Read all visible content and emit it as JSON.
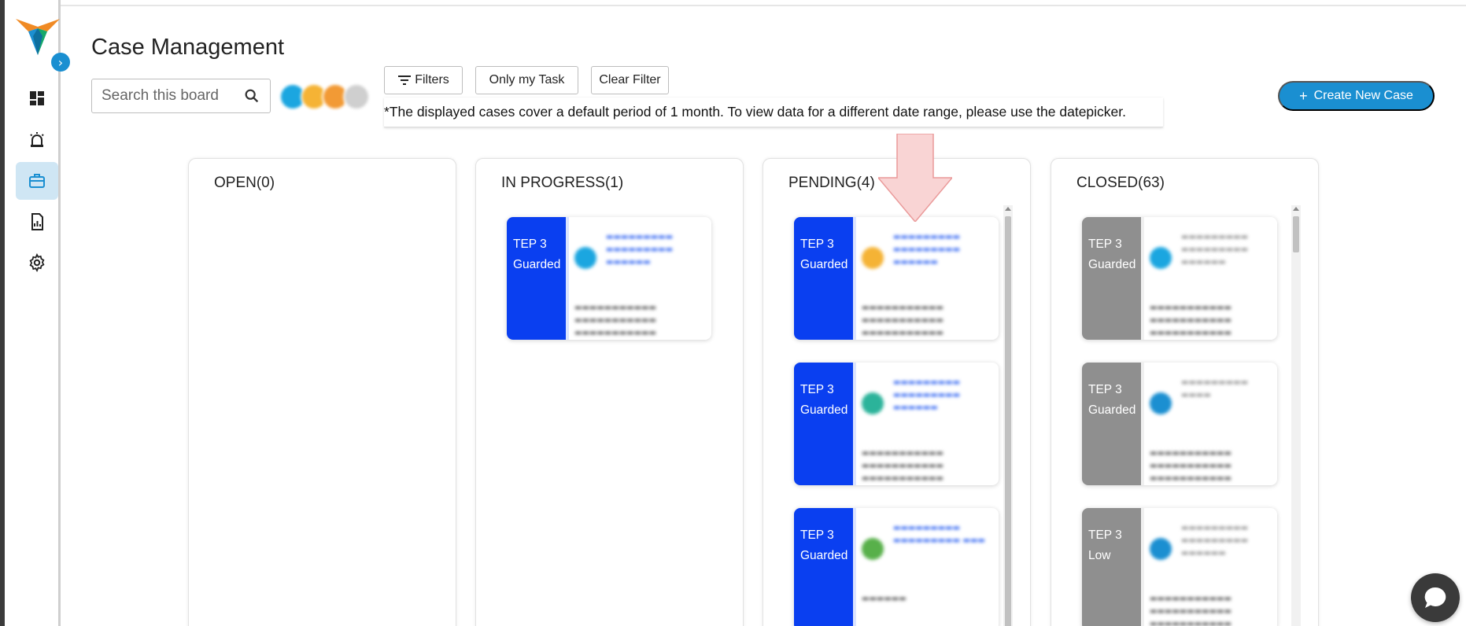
{
  "header": {
    "title": "Case Management",
    "search_placeholder": "Search this board",
    "filters_label": "Filters",
    "only_my_task_label": "Only my Task",
    "clear_filter_label": "Clear Filter",
    "notice": "*The displayed cases cover a default period of 1 month. To view data for a different date range, please use the datepicker.",
    "create_label": "Create New Case"
  },
  "sidebar": {
    "items": [
      {
        "name": "dashboard-icon",
        "active": false
      },
      {
        "name": "alarm-icon",
        "active": false
      },
      {
        "name": "briefcase-icon",
        "active": true
      },
      {
        "name": "report-icon",
        "active": false
      },
      {
        "name": "settings-icon",
        "active": false
      }
    ]
  },
  "colors": {
    "accent": "#1a8fd1",
    "card_blue": "#0a3ff0",
    "card_grey": "#8f8f8f"
  },
  "board": {
    "columns": [
      {
        "title": "OPEN(0)",
        "cards": []
      },
      {
        "title": "IN PROGRESS(1)",
        "cards": [
          {
            "tep": "TEP 3",
            "severity": "Guarded"
          }
        ]
      },
      {
        "title": "PENDING(4)",
        "cards": [
          {
            "tep": "TEP 3",
            "severity": "Guarded"
          },
          {
            "tep": "TEP 3",
            "severity": "Guarded"
          },
          {
            "tep": "TEP 3",
            "severity": "Guarded"
          }
        ]
      },
      {
        "title": "CLOSED(63)",
        "cards": [
          {
            "tep": "TEP 3",
            "severity": "Guarded"
          },
          {
            "tep": "TEP 3",
            "severity": "Guarded"
          },
          {
            "tep": "TEP 3",
            "severity": "Low"
          }
        ]
      }
    ]
  }
}
